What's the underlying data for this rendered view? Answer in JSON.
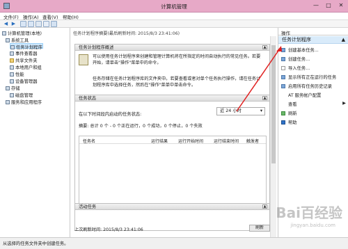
{
  "window": {
    "title": "计算机管理",
    "min": "—",
    "max": "□",
    "close": "✕"
  },
  "menu": [
    "文件(F)",
    "操作(A)",
    "查看(V)",
    "帮助(H)"
  ],
  "tree": {
    "root": "计算机管理(本地)",
    "system_tools": "系统工具",
    "task_scheduler": "任务计划程序",
    "event_viewer": "事件查看器",
    "shared_folders": "共享文件夹",
    "local_users": "本地用户和组",
    "performance": "性能",
    "device_manager": "设备管理器",
    "storage": "存储",
    "disk_management": "磁盘管理",
    "services": "服务和应用程序"
  },
  "center": {
    "header": "任务计划程序摘要(最后刷新时间: 2015/8/3 23:41:06)",
    "overview_title": "任务计划程序概述",
    "overview_p1": "可以使用任务计划程序来创建和管理计算机将在所指定的时间自动执行的常见任务。若要开始，请单击\"操作\"菜单中的命令。",
    "overview_p2": "任务存储在任务计划程序库的文件夹中。若要查看或者对单个任务执行操作，请在任务计划程序库中选择任务，然后在\"操作\"菜单中单击命令。",
    "status_title": "任务状态",
    "status_label": "在以下时间段内启动的任务状态:",
    "period": "近 24 小时",
    "summary": "摘要: 总计 0 个 - 0 个正在运行，0 个成功，0 个停止，0 个失败",
    "columns": [
      "任务名",
      "运行结果",
      "运行开始时间",
      "运行结束时间",
      "触发者"
    ],
    "active_title": "活动任务",
    "last_refresh": "上次刷新时间: 2015/8/3 23:41:06",
    "refresh_btn": "刷新"
  },
  "actions": {
    "header": "操作",
    "section": "任务计划程序",
    "items": [
      "创建基本任务...",
      "创建任务...",
      "导入任务...",
      "显示所有正在运行的任务",
      "启用所有任务历史记录",
      "AT 服务帐户配置",
      "查看",
      "刷新",
      "帮助"
    ]
  },
  "statusbar": "从选择的任务文件夹中创建任务。",
  "watermark": "Bai百经验",
  "watermark2": "jingyan.baidu.com"
}
